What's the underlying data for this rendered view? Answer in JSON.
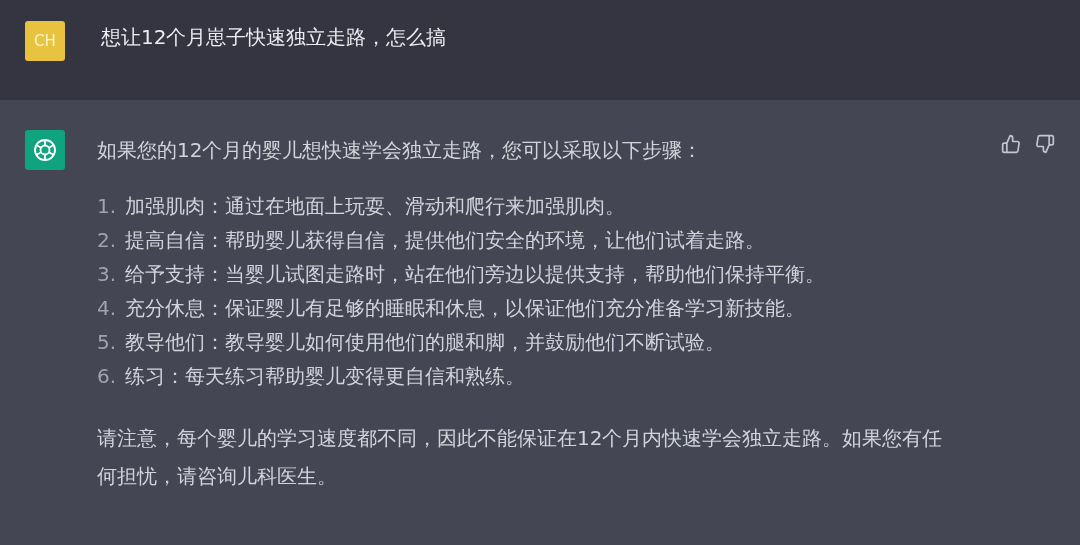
{
  "user_message": {
    "avatar": "CH",
    "text": "想让12个月崽子快速独立走路，怎么搞"
  },
  "assistant_message": {
    "intro": "如果您的12个月的婴儿想快速学会独立走路，您可以采取以下步骤：",
    "steps": [
      {
        "number": "1.",
        "text": "加强肌肉：通过在地面上玩耍、滑动和爬行来加强肌肉。"
      },
      {
        "number": "2.",
        "text": "提高自信：帮助婴儿获得自信，提供他们安全的环境，让他们试着走路。"
      },
      {
        "number": "3.",
        "text": "给予支持：当婴儿试图走路时，站在他们旁边以提供支持，帮助他们保持平衡。"
      },
      {
        "number": "4.",
        "text": "充分休息：保证婴儿有足够的睡眠和休息，以保证他们充分准备学习新技能。"
      },
      {
        "number": "5.",
        "text": "教导他们：教导婴儿如何使用他们的腿和脚，并鼓励他们不断试验。"
      },
      {
        "number": "6.",
        "text": "练习：每天练习帮助婴儿变得更自信和熟练。"
      }
    ],
    "closing": "请注意，每个婴儿的学习速度都不同，因此不能保证在12个月内快速学会独立走路。如果您有任何担忧，请咨询儿科医生。"
  }
}
